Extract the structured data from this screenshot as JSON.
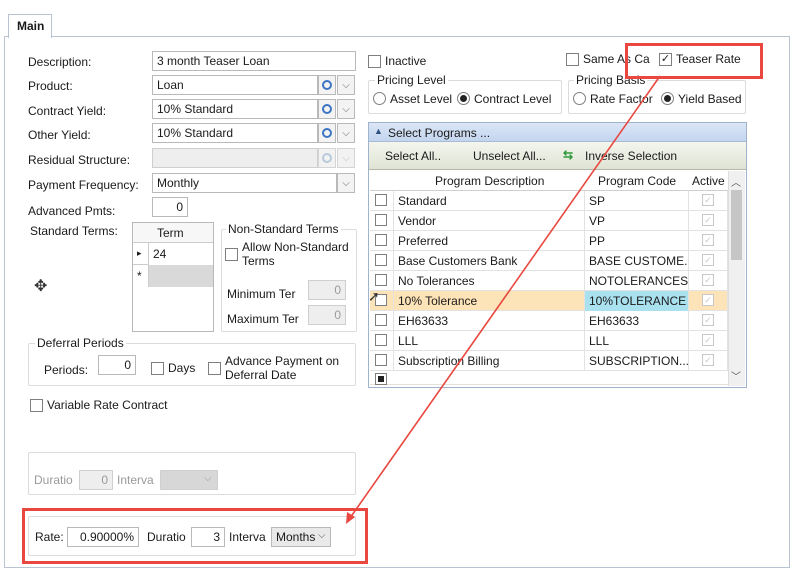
{
  "tab": {
    "main": "Main"
  },
  "form": {
    "description_label": "Description:",
    "description_value": "3 month Teaser Loan",
    "product_label": "Product:",
    "product_value": "Loan",
    "contract_yield_label": "Contract Yield:",
    "contract_yield_value": "10% Standard",
    "other_yield_label": "Other Yield:",
    "other_yield_value": "10% Standard",
    "residual_label": "Residual Structure:",
    "payment_freq_label": "Payment Frequency:",
    "payment_freq_value": "Monthly",
    "advanced_pmts_label": "Advanced Pmts:",
    "advanced_pmts_value": "0",
    "standard_terms_label": "Standard Terms:"
  },
  "terms_grid": {
    "header": "Term",
    "rows": [
      "24"
    ],
    "new_row_marker": "*",
    "current_marker": "▸"
  },
  "nonstandard": {
    "title": "Non-Standard Terms",
    "allow_label_1": "Allow Non-Standard",
    "allow_label_2": "Terms",
    "min_label": "Minimum Ter",
    "min_value": "0",
    "max_label": "Maximum Ter",
    "max_value": "0"
  },
  "deferral": {
    "title": "Deferral Periods",
    "periods_label": "Periods:",
    "periods_value": "0",
    "days_label": "Days",
    "advance_label_1": "Advance Payment on",
    "advance_label_2": "Deferral Date"
  },
  "variable_rate_label": "Variable Rate Contract",
  "variable_section": {
    "duration_label": "Duratio",
    "duration_value": "0",
    "interval_label": "Interva"
  },
  "rate_section": {
    "rate_label": "Rate:",
    "rate_value": "0.90000%",
    "duration_label": "Duratio",
    "duration_value": "3",
    "interval_label": "Interva",
    "interval_value": "Months"
  },
  "inactive_label": "Inactive",
  "same_as_label": "Same As Ca",
  "teaser_rate_label": "Teaser Rate",
  "pricing_level": {
    "title": "Pricing Level",
    "asset": "Asset Level",
    "contract": "Contract Level"
  },
  "pricing_basis": {
    "title": "Pricing Basis",
    "rate_factor": "Rate Factor",
    "yield_based": "Yield Based"
  },
  "programs": {
    "title": "Select Programs ...",
    "select_all": "Select All..",
    "unselect_all": "Unselect All...",
    "inverse": "Inverse Selection",
    "columns": [
      "Program Description",
      "Program Code",
      "Active"
    ],
    "rows": [
      {
        "desc": "Standard",
        "code": "SP"
      },
      {
        "desc": "Vendor",
        "code": "VP"
      },
      {
        "desc": "Preferred",
        "code": "PP"
      },
      {
        "desc": "Base Customers Bank",
        "code": "BASE CUSTOME..."
      },
      {
        "desc": "No Tolerances",
        "code": "NOTOLERANCES"
      },
      {
        "desc": "10% Tolerance",
        "code": "10%TOLERANCE"
      },
      {
        "desc": "EH63633",
        "code": "EH63633"
      },
      {
        "desc": "LLL",
        "code": "LLL"
      },
      {
        "desc": "Subscription Billing",
        "code": "SUBSCRIPTION..."
      }
    ]
  },
  "colors": {
    "highlight": "#e8483f",
    "selected_row": "#fde3b8",
    "selected_cell": "#a9e1ef",
    "header_blue": "#cfdff4"
  }
}
